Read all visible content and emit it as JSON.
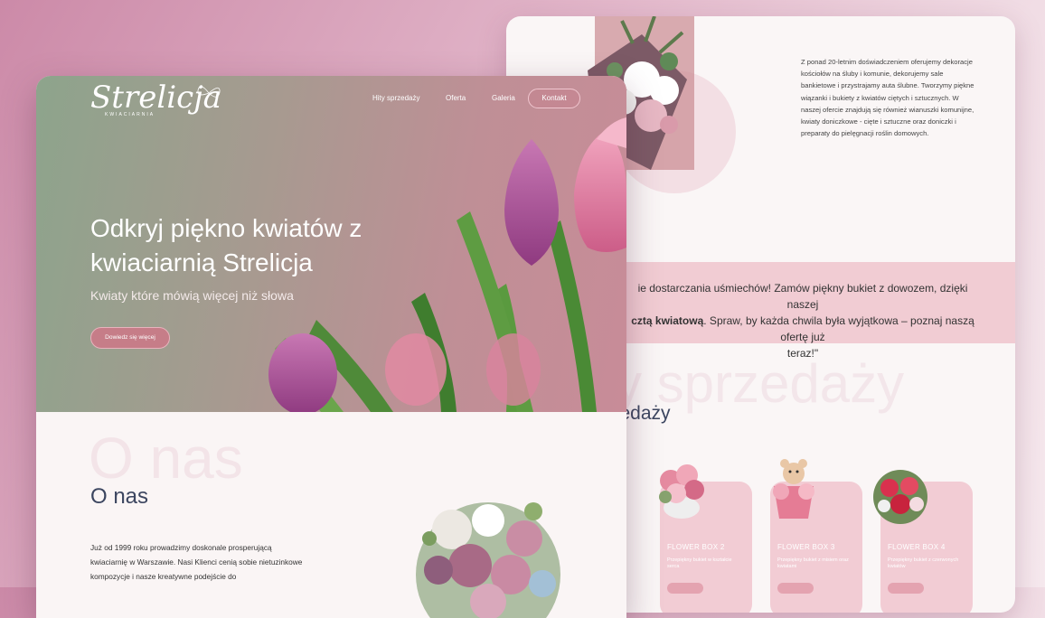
{
  "brand": {
    "logo_script": "Strelicja",
    "logo_sub": "KWIACIARNIA"
  },
  "nav": {
    "items": [
      "Hity sprzedaży",
      "Oferta",
      "Galeria"
    ],
    "cta": "Kontakt"
  },
  "hero": {
    "title": "Odkryj piękno kwiatów z kwiaciarnią Strelicja",
    "subtitle": "Kwiaty które mówią więcej niż słowa",
    "button": "Dowiedz się więcej"
  },
  "about": {
    "ghost_title": "O nas",
    "title": "O nas",
    "paragraph": "Już od 1999 roku prowadzimy doskonale prosperującą kwiaciarnię w Warszawie. Nasi Klienci cenią sobie nietuzinkowe kompozycje i nasze kreatywne podejście do"
  },
  "about_right": {
    "text": "Z ponad 20-letnim doświadczeniem oferujemy dekoracje kościołów na śluby i komunie, dekorujemy sale bankietowe i przystrajamy auta ślubne. Tworzymy piękne wiązanki i bukiety z kwiatów ciętych i sztucznych. W naszej ofercie znajdują się również wianuszki komunijne, kwiaty doniczkowe - cięte i sztuczne oraz doniczki i preparaty do pielęgnacji roślin domowych."
  },
  "quote": {
    "line1": "ie dostarczania uśmiechów! Zamów piękny bukiet z dowozem, dzięki naszej",
    "line2_bold": "cztą kwiatową",
    "line2_rest": ". Spraw, by każda chwila była wyjątkowa – poznaj naszą ofertę już",
    "line3": "teraz!\""
  },
  "bestsellers": {
    "ghost_title": "y sprzedaży",
    "title": "rzedaży",
    "products": [
      {
        "name": "FLOWER BOX 2",
        "desc": "Przepiękny bukiet w kształcie serca"
      },
      {
        "name": "FLOWER BOX 3",
        "desc": "Przepiękny bukiet z misiem oraz kwiatami"
      },
      {
        "name": "FLOWER BOX 4",
        "desc": "Przepiękny bukiet z czerwonych kwiatów"
      }
    ]
  },
  "colors": {
    "accent_pink": "#f2ccd4",
    "heading_navy": "#3c4660",
    "button_pink": "#c67d88"
  }
}
